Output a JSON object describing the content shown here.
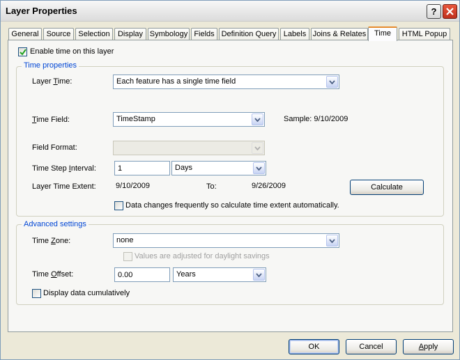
{
  "window": {
    "title": "Layer Properties"
  },
  "tabs": [
    {
      "label": "General"
    },
    {
      "label": "Source"
    },
    {
      "label": "Selection"
    },
    {
      "label": "Display"
    },
    {
      "label": "Symbology"
    },
    {
      "label": "Fields"
    },
    {
      "label": "Definition Query"
    },
    {
      "label": "Labels"
    },
    {
      "label": "Joins & Relates"
    },
    {
      "label": "Time",
      "active": true
    },
    {
      "label": "HTML Popup"
    }
  ],
  "enable_time": {
    "label": "Enable time on this layer",
    "checked": true
  },
  "time_properties": {
    "group_title": "Time properties",
    "layer_time_label": "Layer Time:",
    "layer_time_value": "Each feature has a single time field",
    "time_field_label": "Time Field:",
    "time_field_value": "TimeStamp",
    "sample_text": "Sample: 9/10/2009",
    "field_format_label": "Field Format:",
    "field_format_value": "",
    "step_interval_label": "Time Step Interval:",
    "step_interval_value": "1",
    "step_unit_value": "Days",
    "extent_label": "Layer Time Extent:",
    "extent_start": "9/10/2009",
    "extent_to_label": "To:",
    "extent_end": "9/26/2009",
    "calculate_label": "Calculate",
    "auto_calc_label": "Data changes frequently so calculate time extent automatically.",
    "auto_calc_checked": false
  },
  "advanced": {
    "group_title": "Advanced settings",
    "time_zone_label": "Time Zone:",
    "time_zone_value": "none",
    "daylight_label": "Values are adjusted for daylight savings",
    "daylight_checked": false,
    "offset_label": "Time Offset:",
    "offset_value": "0.00",
    "offset_unit_value": "Years",
    "cumulative_label": "Display data cumulatively",
    "cumulative_checked": false
  },
  "footer": {
    "ok_label": "OK",
    "cancel_label": "Cancel",
    "apply_label": "Apply"
  },
  "colors": {
    "group_title": "#0046d5",
    "active_tab_accent": "#e68b2c",
    "close_button": "#c0301c"
  }
}
